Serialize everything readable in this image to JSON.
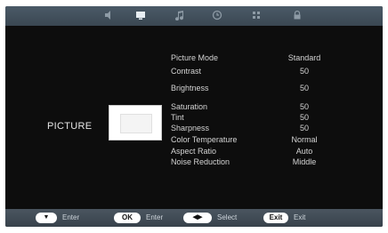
{
  "tabs": [
    {
      "icon": "audio-icon"
    },
    {
      "icon": "picture-icon"
    },
    {
      "icon": "sound-icon"
    },
    {
      "icon": "time-icon"
    },
    {
      "icon": "option-icon"
    },
    {
      "icon": "lock-icon"
    }
  ],
  "section_label": "PICTURE",
  "menu": [
    {
      "label": "Picture Mode",
      "value": "Standard"
    },
    {
      "label": "Contrast",
      "value": "50"
    },
    {
      "label": "Brightness",
      "value": "50"
    },
    {
      "label": "Saturation",
      "value": "50"
    },
    {
      "label": "Tint",
      "value": "50"
    },
    {
      "label": "Sharpness",
      "value": "50"
    },
    {
      "label": "Color Temperature",
      "value": "Normal"
    },
    {
      "label": "Aspect Ratio",
      "value": "Auto"
    },
    {
      "label": "Noise Reduction",
      "value": "Middle"
    }
  ],
  "footer": {
    "enter_key": "▼",
    "enter_label": "Enter",
    "ok_key": "OK",
    "ok_label": "Enter",
    "select_key": "◀▶",
    "select_label": "Select",
    "exit_key": "Exit",
    "exit_label": "Exit"
  },
  "colors": {
    "panel": "#0d0d0d",
    "bar": "#3f4c57",
    "text": "#d4d4d4"
  }
}
